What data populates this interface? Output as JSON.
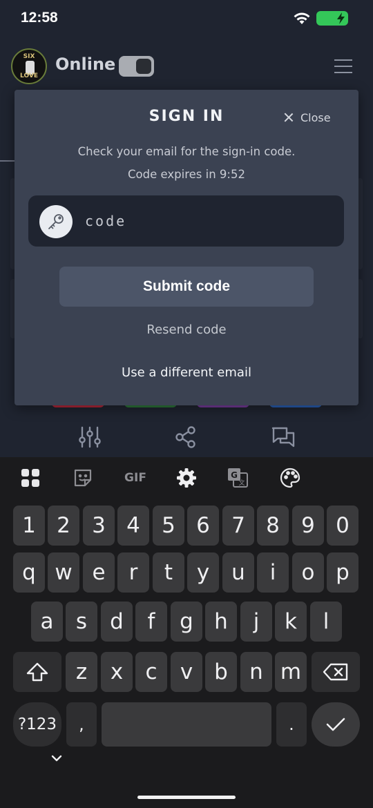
{
  "status_bar": {
    "time": "12:58"
  },
  "app_header": {
    "logo_top_text": "SIX",
    "logo_bottom_text": "LOVE",
    "online_label": "Online",
    "menu_icon": "hamburger-menu-icon"
  },
  "modal": {
    "title": "SIGN IN",
    "close_label": "Close",
    "message": "Check your email for the sign-in code.",
    "expiry": "Code expires in 9:52",
    "code_placeholder": "code",
    "code_value": "",
    "submit_label": "Submit code",
    "resend_label": "Resend code",
    "different_email_label": "Use a different email"
  },
  "bottom_tools": {
    "icons": [
      "sliders-icon",
      "share-icon",
      "chat-icon"
    ]
  },
  "keyboard": {
    "toolbar_icons": [
      "apps-grid-icon",
      "sticker-icon",
      "gif-icon",
      "settings-gear-icon",
      "translate-icon",
      "palette-icon"
    ],
    "gif_label": "GIF",
    "row_numbers": [
      "1",
      "2",
      "3",
      "4",
      "5",
      "6",
      "7",
      "8",
      "9",
      "0"
    ],
    "row1": [
      "q",
      "w",
      "e",
      "r",
      "t",
      "y",
      "u",
      "i",
      "o",
      "p"
    ],
    "row2": [
      "a",
      "s",
      "d",
      "f",
      "g",
      "h",
      "j",
      "k",
      "l"
    ],
    "row3": [
      "z",
      "x",
      "c",
      "v",
      "b",
      "n",
      "m"
    ],
    "symbols_label": "?123",
    "comma_label": ",",
    "period_label": "."
  },
  "colors": {
    "background": "#1f2430",
    "modal": "#3b4252",
    "submit_button": "#4c5568",
    "battery": "#34c759",
    "keyboard": "#1b1b1d"
  }
}
